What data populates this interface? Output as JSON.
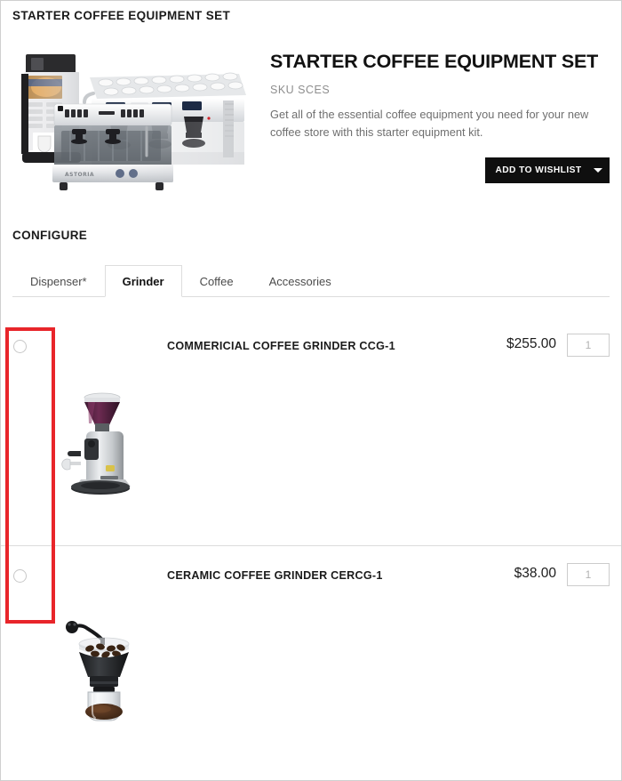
{
  "page": {
    "breadcrumb_title": "STARTER COFFEE EQUIPMENT SET"
  },
  "product": {
    "title": "STARTER COFFEE EQUIPMENT SET",
    "sku": "SKU SCES",
    "description": "Get all of the essential coffee equipment you need for your new coffee store with this starter equipment kit.",
    "image_alt": "starter-coffee-equipment-set-image"
  },
  "wishlist": {
    "label": "ADD TO WISHLIST",
    "caret_icon": "chevron-down-icon",
    "background": "#0f0f0f",
    "text_color": "#ffffff"
  },
  "configure": {
    "heading": "CONFIGURE",
    "tabs": [
      {
        "label": "Dispenser*",
        "active": false
      },
      {
        "label": "Grinder",
        "active": true
      },
      {
        "label": "Coffee",
        "active": false
      },
      {
        "label": "Accessories",
        "active": false
      }
    ],
    "options": [
      {
        "title": "COMMERICIAL COFFEE GRINDER CCG-1",
        "price": "$255.00",
        "qty_value": "1",
        "qty_placeholder": "1",
        "selected": false,
        "thumb_alt": "commercial-coffee-grinder-thumbnail"
      },
      {
        "title": "CERAMIC COFFEE GRINDER CERCG-1",
        "price": "$38.00",
        "qty_value": "1",
        "qty_placeholder": "1",
        "selected": false,
        "thumb_alt": "ceramic-coffee-grinder-thumbnail"
      }
    ]
  },
  "annotation": {
    "color": "#e8252a",
    "target": "radio-button-column"
  }
}
